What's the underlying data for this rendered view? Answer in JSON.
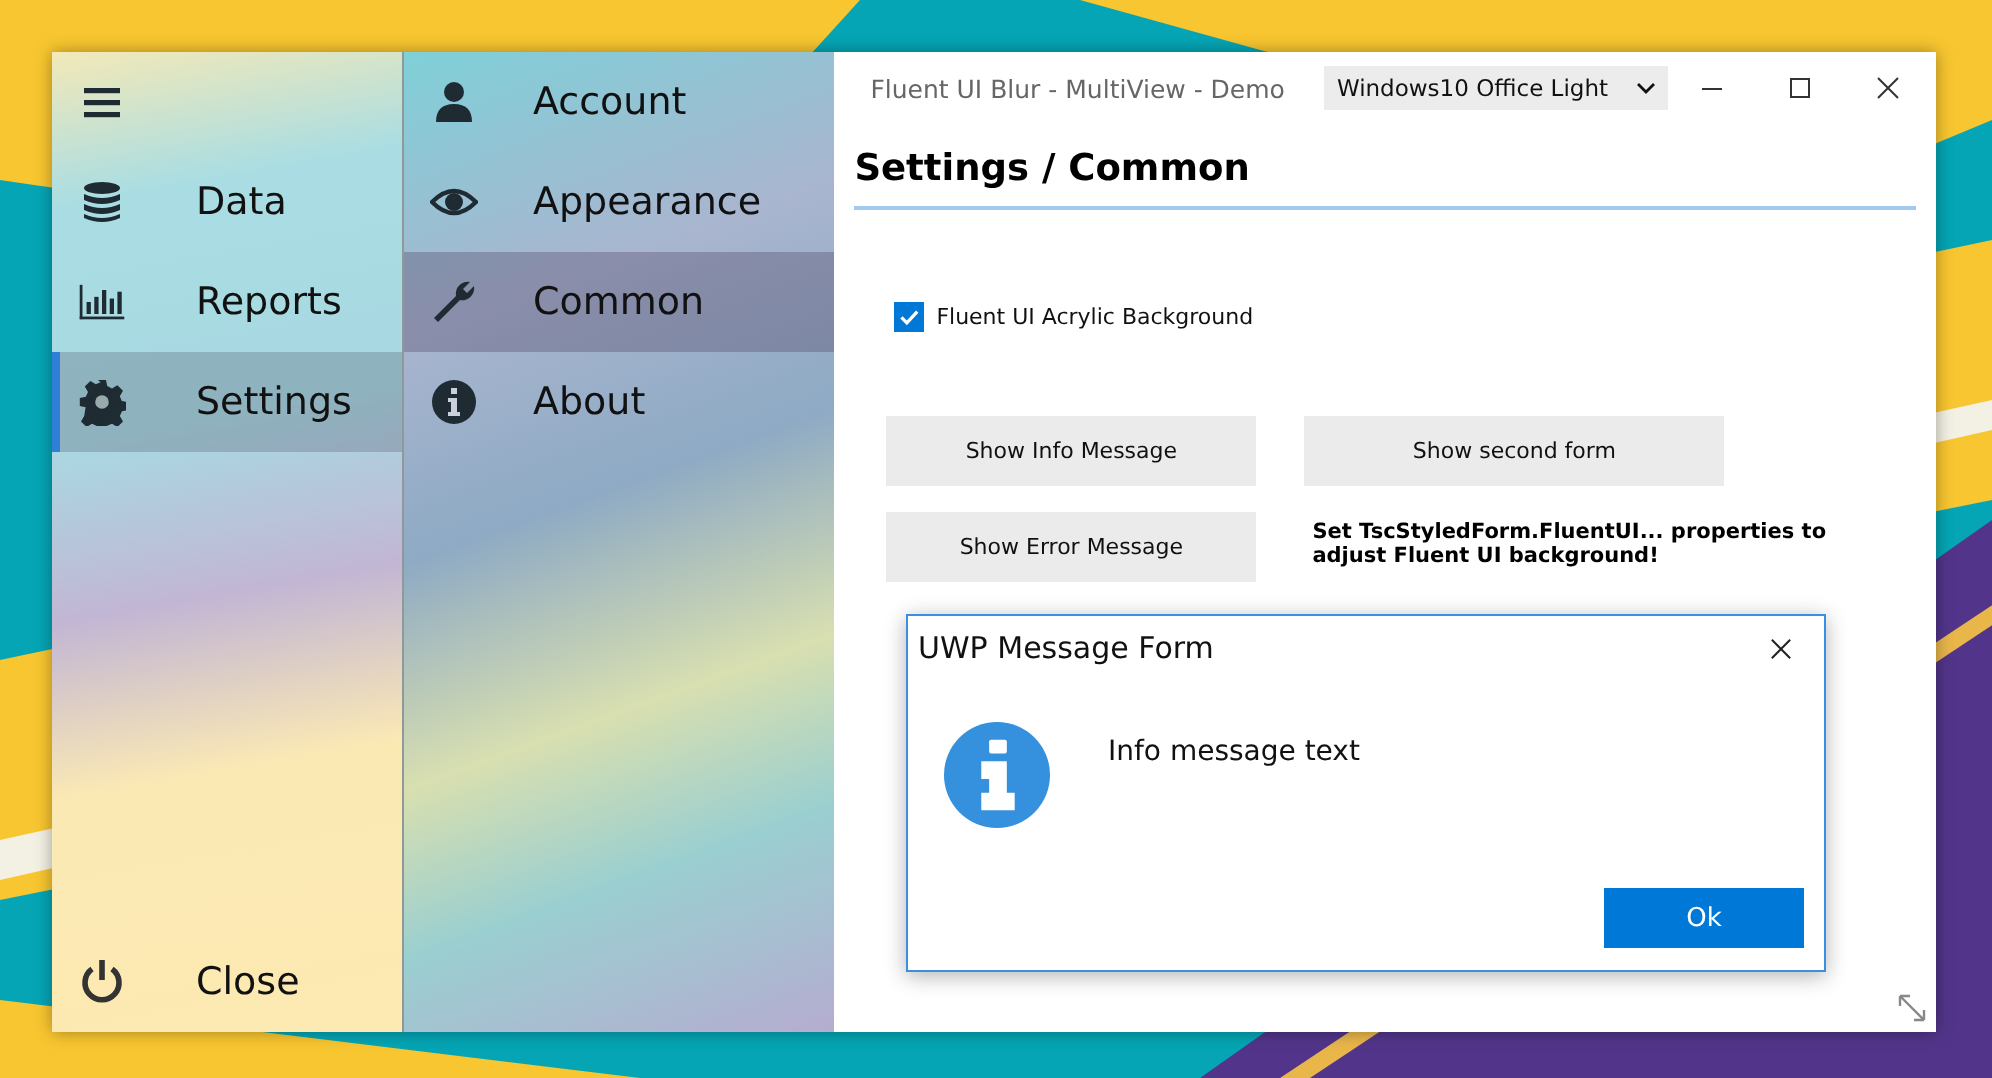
{
  "window": {
    "title": "Fluent UI Blur - MultiView - Demo",
    "theme_dropdown": "Windows10 Office Light"
  },
  "nav": {
    "items": [
      {
        "label": "Data",
        "selected": false
      },
      {
        "label": "Reports",
        "selected": false
      },
      {
        "label": "Settings",
        "selected": true
      }
    ],
    "close": "Close"
  },
  "subnav": {
    "items": [
      {
        "label": "Account",
        "selected": false
      },
      {
        "label": "Appearance",
        "selected": false
      },
      {
        "label": "Common",
        "selected": true
      },
      {
        "label": "About",
        "selected": false
      }
    ]
  },
  "content": {
    "heading": "Settings / Common",
    "checkbox": {
      "label": "Fluent UI Acrylic Background",
      "checked": true
    },
    "buttons": [
      "Show Info Message",
      "Show second form",
      "Show Error Message"
    ],
    "note": "Set TscStyledForm.FluentUI... properties to adjust Fluent UI background!"
  },
  "dialog": {
    "title": "UWP Message Form",
    "message": "Info message text",
    "button": "Ok"
  }
}
